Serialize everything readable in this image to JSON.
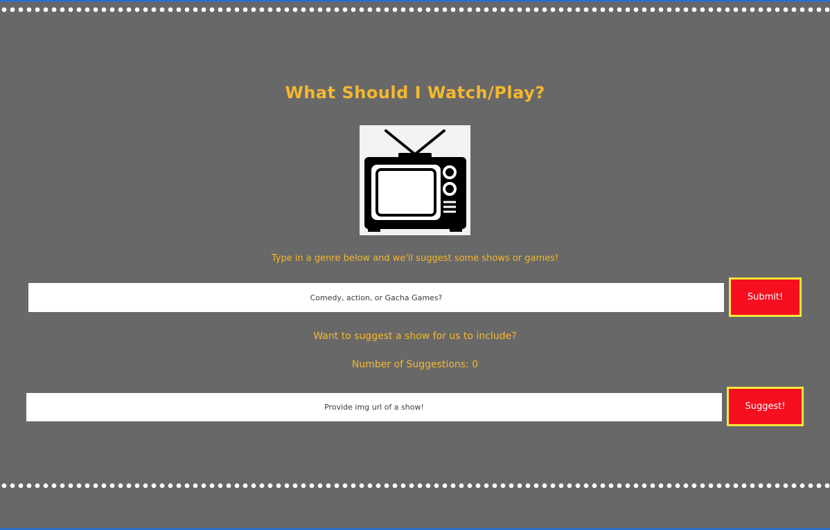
{
  "header": {
    "title": "What Should I Watch/Play?"
  },
  "hero": {
    "image_icon": "tv-icon"
  },
  "genre_search": {
    "intro": "Type in a genre below and we'll suggest some shows or games!",
    "placeholder": "Comedy, action, or Gacha Games?",
    "value": "",
    "submit_label": "Submit!"
  },
  "suggestion": {
    "heading": "Want to suggest a show for us to include?",
    "count_label": "Number of Suggestions: 0",
    "placeholder": "Provide img url of a show!",
    "value": "",
    "suggest_label": "Suggest!"
  },
  "colors": {
    "background": "#686868",
    "accent_text": "#f5b82e",
    "button_fill": "#f50f1f",
    "button_border": "#f2ea3a",
    "dots": "#ffffff"
  }
}
